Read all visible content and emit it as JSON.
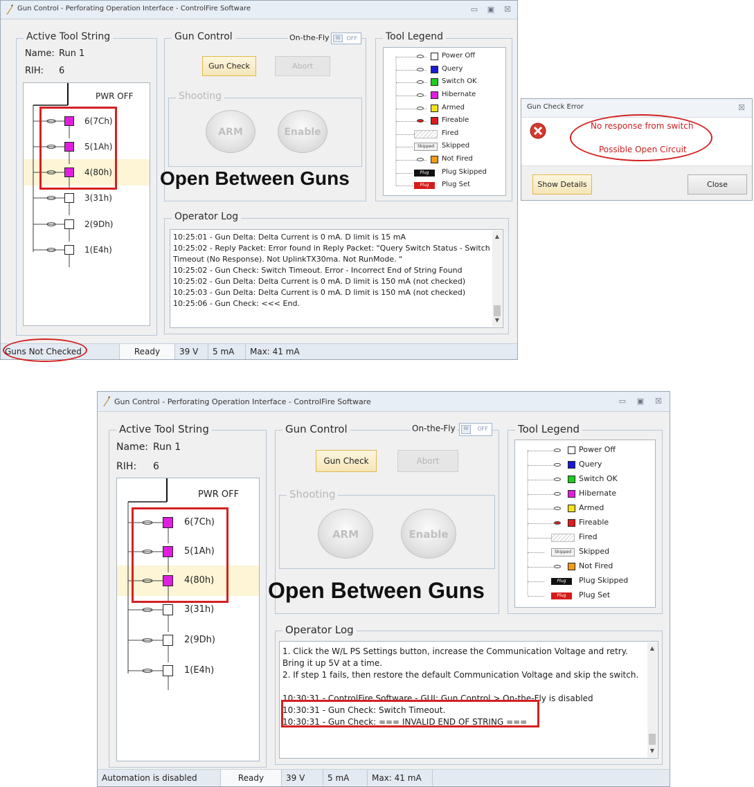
{
  "window1": {
    "title": "Gun Control - Perforating Operation Interface - ControlFire Software",
    "controls": {
      "minimize": "▭",
      "maximize": "▣",
      "close": "☒"
    },
    "active_tool_string": {
      "title": "Active Tool String",
      "name_label": "Name:",
      "name_value": "Run 1",
      "rih_label": "RIH:",
      "rih_value": "6",
      "pwr_label": "PWR OFF",
      "switches": [
        {
          "label": "6(7Ch)",
          "state": "Hibernate"
        },
        {
          "label": "5(1Ah)",
          "state": "Hibernate"
        },
        {
          "label": "4(80h)",
          "state": "Hibernate"
        },
        {
          "label": "3(31h)",
          "state": "Power Off"
        },
        {
          "label": "2(9Dh)",
          "state": "Power Off"
        },
        {
          "label": "1(E4h)",
          "state": "Power Off"
        }
      ]
    },
    "gun_control": {
      "title": "Gun Control",
      "on_the_fly_label": "On-the-Fly",
      "toggle_off": "OFF",
      "gun_check_label": "Gun Check",
      "abort_label": "Abort",
      "shooting_title": "Shooting",
      "arm_label": "ARM",
      "enable_label": "Enable"
    },
    "tool_legend": {
      "title": "Tool Legend",
      "items": [
        {
          "label": "Power Off",
          "color": "#ffffff",
          "style": "switch"
        },
        {
          "label": "Query",
          "color": "#1a1ad6",
          "style": "switch"
        },
        {
          "label": "Switch OK",
          "color": "#1dcc1d",
          "style": "switch"
        },
        {
          "label": "Hibernate",
          "color": "#e01ee0",
          "style": "switch"
        },
        {
          "label": "Armed",
          "color": "#f2e11b",
          "style": "switch"
        },
        {
          "label": "Fireable",
          "color": "#e01b1b",
          "style": "switch-red"
        },
        {
          "label": "Fired",
          "color": "#eeeeee",
          "style": "hatched"
        },
        {
          "label": "Skipped",
          "color": "#eeeeee",
          "style": "tag",
          "tag": "Skipped"
        },
        {
          "label": "Not Fired",
          "color": "#f29a1b",
          "style": "switch"
        },
        {
          "label": "Plug Skipped",
          "color": "#111111",
          "style": "plug",
          "tag": "Plug"
        },
        {
          "label": "Plug Set",
          "color": "#d61b1b",
          "style": "plug",
          "tag": "Plug"
        }
      ]
    },
    "overlay_text": "Open Between Guns",
    "operator_log": {
      "title": "Operator Log",
      "lines": [
        "10:25:01 - Gun Delta: Delta Current is 0 mA. D limit is 15 mA",
        "10:25:02 - Reply Packet: Error found in Reply Packet: \"Query Switch Status - Switch",
        "Timeout (No Response). Not UplinkTX30ma. Not RunMode. \"",
        "10:25:02 - Gun Check: Switch Timeout. Error - Incorrect End of String Found",
        "10:25:02 - Gun Delta: Delta Current is 0 mA. D limit is 150 mA (not checked)",
        "10:25:03 - Gun Delta: Delta Current is 0 mA. D limit is 150 mA (not checked)",
        "10:25:06 - Gun Check: <<< End."
      ]
    },
    "status_bar": {
      "message": "Guns Not Checked",
      "ready": "Ready",
      "voltage": "39 V",
      "current": "5 mA",
      "max": "Max: 41 mA"
    }
  },
  "error_dialog": {
    "title": "Gun Check Error",
    "close_glyph": "☒",
    "message_line1": "No response from switch",
    "message_line2": "Possible Open Circuit",
    "show_details_label": "Show Details",
    "close_label": "Close"
  },
  "window2": {
    "title": "Gun Control - Perforating Operation Interface - ControlFire Software",
    "controls": {
      "minimize": "▭",
      "maximize": "▣",
      "close": "☒"
    },
    "active_tool_string": {
      "title": "Active Tool String",
      "name_label": "Name:",
      "name_value": "Run 1",
      "rih_label": "RIH:",
      "rih_value": "6",
      "pwr_label": "PWR OFF",
      "switches": [
        {
          "label": "6(7Ch)",
          "state": "Hibernate"
        },
        {
          "label": "5(1Ah)",
          "state": "Hibernate"
        },
        {
          "label": "4(80h)",
          "state": "Hibernate"
        },
        {
          "label": "3(31h)",
          "state": "Power Off"
        },
        {
          "label": "2(9Dh)",
          "state": "Power Off"
        },
        {
          "label": "1(E4h)",
          "state": "Power Off"
        }
      ]
    },
    "gun_control": {
      "title": "Gun Control",
      "on_the_fly_label": "On-the-Fly",
      "toggle_off": "OFF",
      "gun_check_label": "Gun Check",
      "abort_label": "Abort",
      "shooting_title": "Shooting",
      "arm_label": "ARM",
      "enable_label": "Enable"
    },
    "tool_legend": {
      "title": "Tool Legend",
      "items": [
        {
          "label": "Power Off",
          "color": "#ffffff",
          "style": "switch"
        },
        {
          "label": "Query",
          "color": "#1a1ad6",
          "style": "switch"
        },
        {
          "label": "Switch OK",
          "color": "#1dcc1d",
          "style": "switch"
        },
        {
          "label": "Hibernate",
          "color": "#e01ee0",
          "style": "switch"
        },
        {
          "label": "Armed",
          "color": "#f2e11b",
          "style": "switch"
        },
        {
          "label": "Fireable",
          "color": "#e01b1b",
          "style": "switch-red"
        },
        {
          "label": "Fired",
          "color": "#eeeeee",
          "style": "hatched"
        },
        {
          "label": "Skipped",
          "color": "#eeeeee",
          "style": "tag",
          "tag": "Skipped"
        },
        {
          "label": "Not Fired",
          "color": "#f29a1b",
          "style": "switch"
        },
        {
          "label": "Plug Skipped",
          "color": "#111111",
          "style": "plug",
          "tag": "Plug"
        },
        {
          "label": "Plug Set",
          "color": "#d61b1b",
          "style": "plug",
          "tag": "Plug"
        }
      ]
    },
    "overlay_text": "Open Between Guns",
    "operator_log": {
      "title": "Operator Log",
      "lines": [
        "1. Click the W/L PS Settings button, increase the Communication Voltage and retry.",
        "Bring it up 5V at a time.",
        "2. If step 1 fails, then restore the default Communication Voltage and skip the switch.",
        "",
        "10:30:31 - ControlFire Software - GUI: Gun Control > On-the-Fly is disabled",
        "10:30:31 - Gun Check:  Switch Timeout.",
        "10:30:31 - Gun Check: === INVALID END OF STRING ==="
      ]
    },
    "status_bar": {
      "message": "Automation is disabled",
      "ready": "Ready",
      "voltage": "39 V",
      "current": "5 mA",
      "max": "Max: 41 mA"
    }
  }
}
